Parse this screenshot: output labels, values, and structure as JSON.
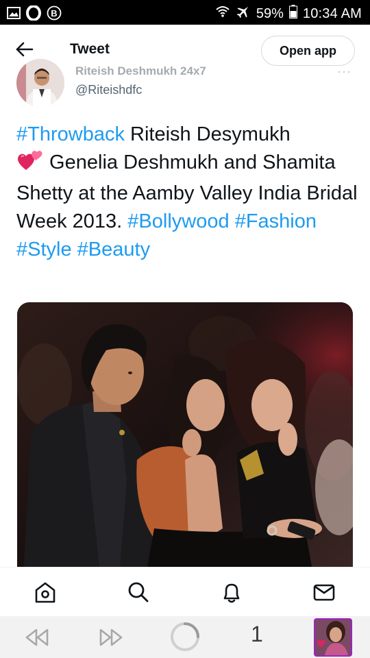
{
  "status_bar": {
    "battery": "59%",
    "time": "10:34 AM",
    "icons": [
      "gallery-icon",
      "opera-icon",
      "b-icon",
      "wifi-icon",
      "airplane-icon",
      "battery-icon"
    ]
  },
  "header": {
    "title": "Tweet",
    "open_app_label": "Open app",
    "back_icon": "back-arrow-icon"
  },
  "author": {
    "name": "Riteish Deshmukh 24x7",
    "handle": "@Riteishdfc",
    "more": "···"
  },
  "tweet": {
    "hashtag_throwback": "#Throwback",
    "text_1": " Riteish Desymukh ",
    "text_2": " Genelia Deshmukh and Shamita Shetty at the Aamby Valley India Bridal Week 2013. ",
    "hashtag_bollywood": "#Bollywood",
    "hashtag_fashion": "#Fashion",
    "hashtag_style": "#Style",
    "hashtag_beauty": "#Beauty",
    "emoji": "two-hearts-icon",
    "link_color": "#1d9bf0"
  },
  "tabbar": {
    "items": [
      "home-icon",
      "search-icon",
      "notifications-icon",
      "messages-icon"
    ]
  },
  "browser_nav": {
    "tab_count": "1",
    "icons": [
      "back-icon",
      "forward-icon",
      "loading-icon",
      "tab-thumbnail"
    ]
  }
}
